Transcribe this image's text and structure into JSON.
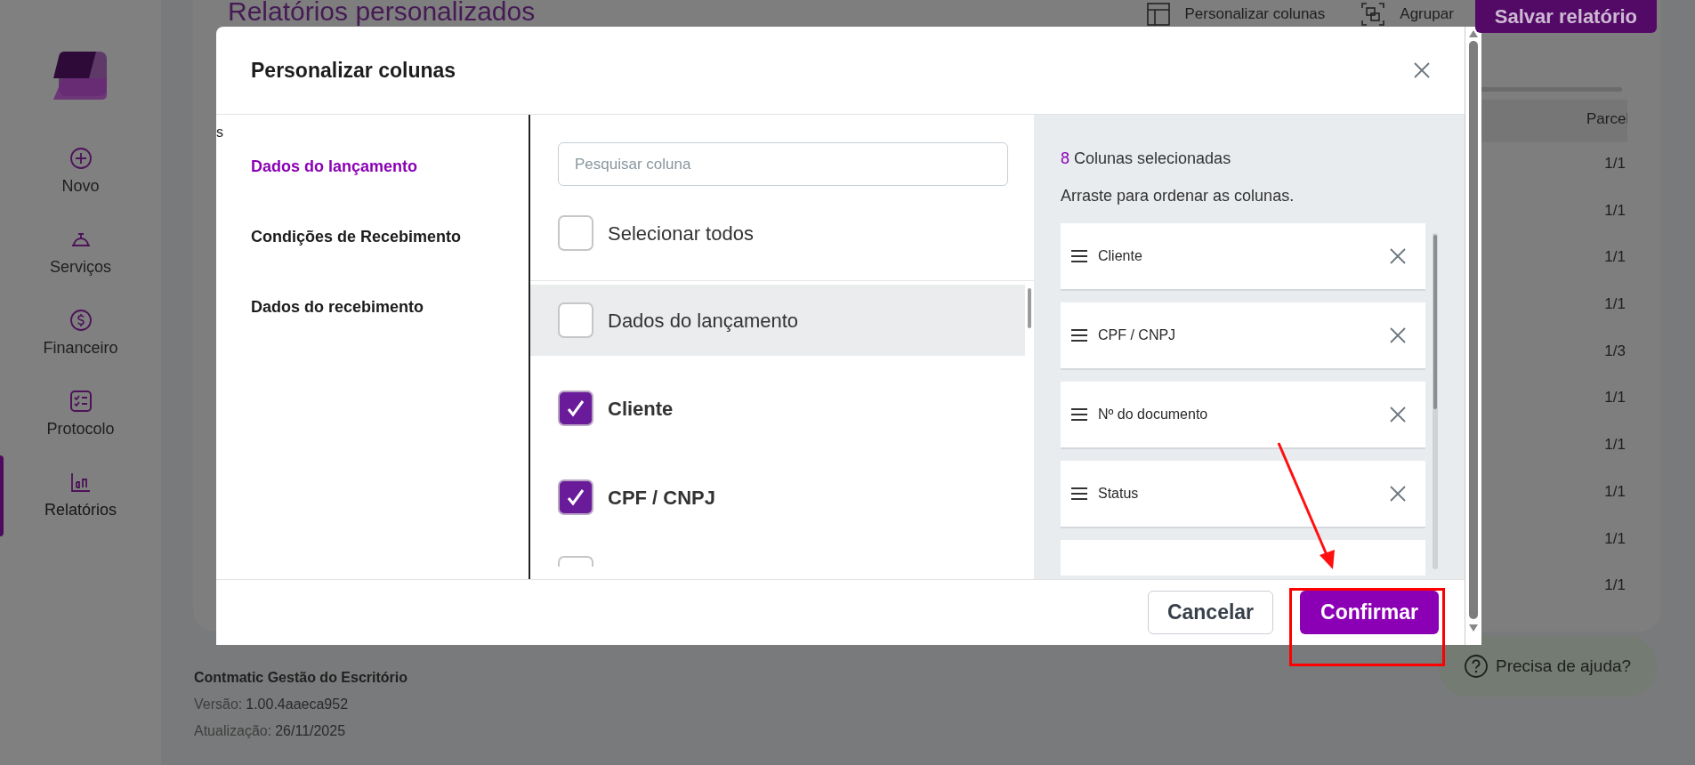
{
  "sidebar": {
    "items": [
      {
        "label": "Novo",
        "kind": "plus",
        "selected": false
      },
      {
        "label": "Serviços",
        "kind": "bell",
        "selected": false
      },
      {
        "label": "Financeiro",
        "kind": "dollar",
        "selected": false
      },
      {
        "label": "Protocolo",
        "kind": "checklist",
        "selected": false
      },
      {
        "label": "Relatórios",
        "kind": "chart",
        "selected": true
      }
    ]
  },
  "page": {
    "title": "Relatórios personalizados",
    "toolbar": [
      {
        "label": "Personalizar colunas",
        "kind": "table"
      },
      {
        "label": "Agrupar",
        "kind": "group"
      }
    ],
    "save_button": "Salvar relatório",
    "table": {
      "column": "Parcel",
      "values": [
        "1/1",
        "1/1",
        "1/1",
        "1/1",
        "1/3",
        "1/1",
        "1/1",
        "1/1",
        "1/1",
        "1/1"
      ]
    }
  },
  "modal": {
    "title": "Personalizar colunas",
    "stray_text": "s",
    "categories": [
      {
        "label": "Dados do lançamento",
        "selected": true
      },
      {
        "label": "Condições de Recebimento",
        "selected": false
      },
      {
        "label": "Dados do recebimento",
        "selected": false
      }
    ],
    "search": {
      "placeholder": "Pesquisar coluna"
    },
    "select_all": {
      "label": "Selecionar todos",
      "checked": false
    },
    "options": [
      {
        "kind": "group",
        "label": "Dados do lançamento",
        "checked": false
      },
      {
        "kind": "item",
        "label": "Cliente",
        "checked": true
      },
      {
        "kind": "item",
        "label": "CPF / CNPJ",
        "checked": true
      },
      {
        "kind": "cut",
        "checked": false
      }
    ],
    "count": "8",
    "count_label": "Colunas selecionadas",
    "hint": "Arraste para ordenar as colunas.",
    "selected_columns": [
      "Cliente",
      "CPF / CNPJ",
      "Nº do documento",
      "Status"
    ],
    "buttons": {
      "cancel": "Cancelar",
      "confirm": "Confirmar"
    }
  },
  "footer": {
    "app": "Contmatic Gestão do Escritório",
    "version_label": "Versão:",
    "version": "1.00.4aaeca952",
    "update_label": "Atualização:",
    "update": "26/11/2025"
  },
  "help": "Precisa de ajuda?"
}
